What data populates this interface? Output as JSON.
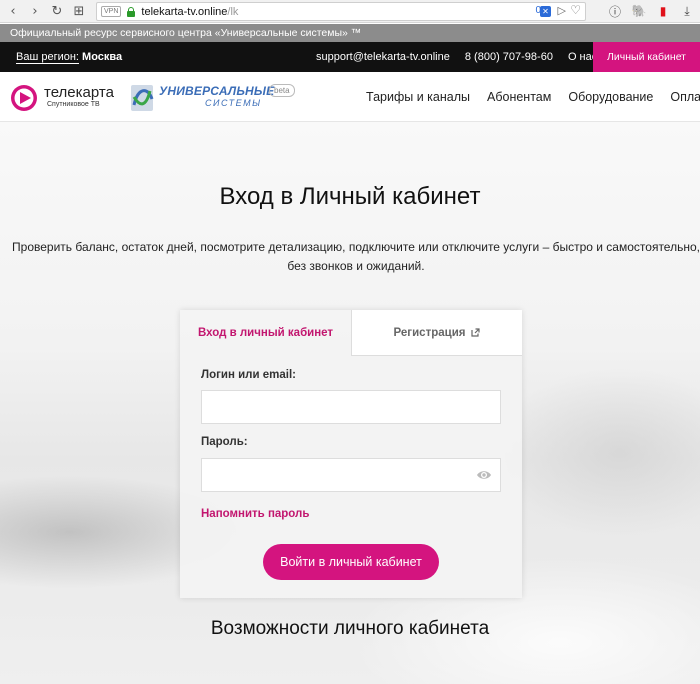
{
  "browser": {
    "vpn_label": "VPN",
    "url_host": "telekarta-tv.online",
    "url_path": "/lk",
    "badge_count": "0"
  },
  "official_notice": "Официальный ресурс сервисного центра «Универсальные системы» ™",
  "topbar": {
    "region_label": "Ваш регион:",
    "region_value": "Москва",
    "email": "support@telekarta-tv.online",
    "phone": "8 (800) 707-98-60",
    "about": "О нас",
    "cabinet": "Личный кабинет"
  },
  "header": {
    "logo_title": "телекарта",
    "logo_subtitle": "Спутниковое ТВ",
    "partner_name": "УНИВЕРСАЛЬНЫЕ",
    "partner_sub": "СИСТЕМЫ",
    "beta": "beta",
    "nav": [
      "Тарифы и каналы",
      "Абонентам",
      "Оборудование",
      "Оплата"
    ]
  },
  "hero": {
    "title": "Вход в Личный кабинет",
    "description_line1": "Проверить баланс, остаток дней, посмотрите детализацию, подключите или отключите услуги – быстро и самостоятельно,",
    "description_line2": "без звонков и ожиданий."
  },
  "login": {
    "tab_login": "Вход в личный кабинет",
    "tab_register": "Регистрация",
    "login_label": "Логин или email:",
    "login_value": "",
    "password_label": "Пароль:",
    "password_value": "",
    "remind": "Напомнить пароль",
    "submit": "Войти в личный кабинет"
  },
  "features_title": "Возможности личного кабинета",
  "colors": {
    "accent": "#d4147f",
    "link": "#c2166f",
    "partner_blue": "#3b6db7"
  }
}
